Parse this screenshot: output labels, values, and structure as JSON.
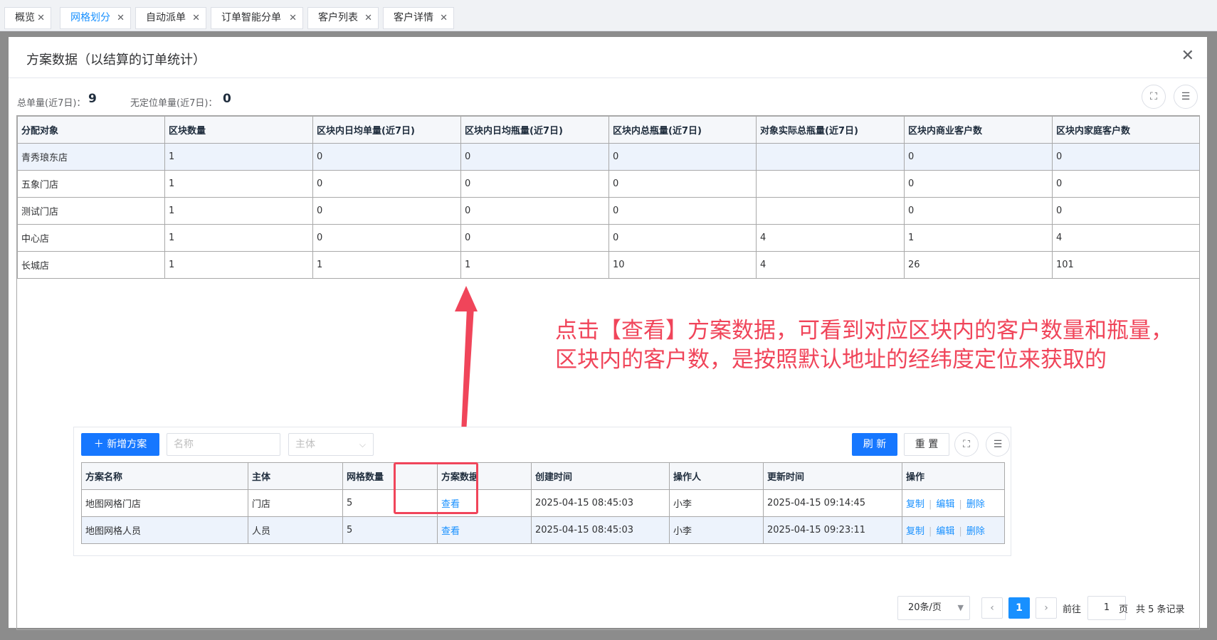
{
  "tabs": [
    {
      "label": "概览",
      "active": false
    },
    {
      "label": "网格划分",
      "active": true
    },
    {
      "label": "自动派单",
      "active": false
    },
    {
      "label": "订单智能分单",
      "active": false
    },
    {
      "label": "客户列表",
      "active": false
    },
    {
      "label": "客户详情",
      "active": false
    }
  ],
  "dialog": {
    "title": "方案数据（以结算的订单统计）",
    "close_glyph": "✕",
    "stats": {
      "total_label": "总单量(近7日)：",
      "total_value": "9",
      "unlocated_label": "无定位单量(近7日)：",
      "unlocated_value": "0"
    },
    "table": {
      "headers": [
        "分配对象",
        "区块数量",
        "区块内日均单量(近7日)",
        "区块内日均瓶量(近7日)",
        "区块内总瓶量(近7日)",
        "对象实际总瓶量(近7日)",
        "区块内商业客户数",
        "区块内家庭客户数"
      ],
      "rows": [
        [
          "青秀琅东店",
          "1",
          "0",
          "0",
          "0",
          "",
          "0",
          "0"
        ],
        [
          "五象门店",
          "1",
          "0",
          "0",
          "0",
          "",
          "0",
          "0"
        ],
        [
          "测试门店",
          "1",
          "0",
          "0",
          "0",
          "",
          "0",
          "0"
        ],
        [
          "中心店",
          "1",
          "0",
          "0",
          "0",
          "4",
          "1",
          "4"
        ],
        [
          "长城店",
          "1",
          "1",
          "1",
          "10",
          "4",
          "26",
          "101"
        ]
      ]
    }
  },
  "annotation": {
    "line1": "点击【查看】方案数据，可看到对应区块内的客户数量和瓶量，",
    "line2": "区块内的客户数，是按照默认地址的经纬度定位来获取的",
    "color": "#f0455a"
  },
  "scheme_panel": {
    "add_button": "＋ 新增方案",
    "name_placeholder": "名称",
    "subject_placeholder": "主体",
    "refresh_button": "刷 新",
    "reset_button": "重 置",
    "table": {
      "headers": [
        "方案名称",
        "主体",
        "网格数量",
        "方案数据",
        "创建时间",
        "操作人",
        "更新时间",
        "操作"
      ],
      "rows": [
        {
          "name": "地图网格门店",
          "subject": "门店",
          "grid_count": "5",
          "view": "查看",
          "created": "2025-04-15 08:45:03",
          "operator": "小李",
          "updated": "2025-04-15 09:14:45"
        },
        {
          "name": "地图网格人员",
          "subject": "人员",
          "grid_count": "5",
          "view": "查看",
          "created": "2025-04-15 08:45:03",
          "operator": "小李",
          "updated": "2025-04-15 09:23:11"
        }
      ],
      "actions": [
        "复制",
        "编辑",
        "删除"
      ]
    }
  },
  "pagination": {
    "page_size": "20条/页",
    "current_page": "1",
    "goto_label": "前往",
    "goto_value": "1",
    "page_unit": "页",
    "total_text": "共 5 条记录"
  },
  "icons": {
    "fullscreen": "fullscreen-icon",
    "column_settings": "list-icon",
    "prev": "chevron-left-icon",
    "next": "chevron-right-icon"
  },
  "colors": {
    "primary": "#1677ff",
    "link": "#1890ff",
    "annotation": "#f0455a",
    "row_highlight": "#edf3fc"
  }
}
